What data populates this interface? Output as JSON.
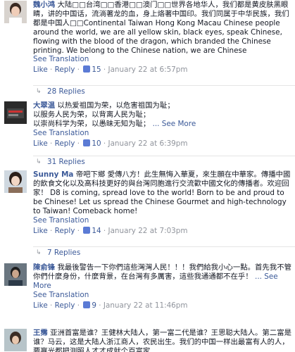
{
  "comments": [
    {
      "author": "魏小鸿",
      "text": "大陆□□台湾□□香港□□澳门□□世界各地华人，我们都是黄皮肤黑眼睛，讲的中国话，流淌著龙的血，身上烙著中国印。我们同属于中华民族，我们都是中国人□□Continental Taiwan Hong Kong Macau Chinese people around the world, we are all yellow skin, black eyes, speak Chinese, flowing with the blood of the dragon, which branded the Chinese printing. We belong to the Chinese nation, we are Chinese",
      "see_translation": "See Translation",
      "like": "Like",
      "reply": "Reply",
      "likes": "15",
      "timestamp": "January 22 at 6:57pm",
      "replies": "28 Replies"
    },
    {
      "author": "大翠温",
      "text_lines": [
        "以热爱祖国为荣，以危害祖国为耻；",
        "以服务人民为荣，以背离人民为耻；",
        "以崇尚科学为荣，以愚昧无知为耻；"
      ],
      "see_more": "... See More",
      "see_translation": "See Translation",
      "like": "Like",
      "reply": "Reply",
      "likes": "10",
      "timestamp": "January 22 at 6:39pm",
      "replies": "31 Replies"
    },
    {
      "author": "Sunny Ma",
      "text": "帝吧下鄉 愛傳八方！此生無悔入華夏，來生願在中華家。傳播中國的飲食文化以及高科技更好的與台灣同胞進行交流歡中國文化的傳播者。欢迎回家！ D8 is coming, spread love to the world! Born to be and proud to be Chinese! Let us spread the Chinese Gourmet and high-technology to Taiwan! Comeback home!",
      "see_translation": "See Translation",
      "like": "Like",
      "reply": "Reply",
      "likes": "14",
      "timestamp": "January 22 at 7:03pm",
      "replies": "7 Replies"
    },
    {
      "author": "陳俞锋",
      "text": "我最後警告一下你們這些灣灣人民！！！我們給我小心一點。首先我不管你們什麼身份，什麼背景，在台灣有多厲害，這些我通通都不在乎！",
      "see_more": "... See More",
      "see_translation": "See Translation",
      "like": "Like",
      "reply": "Reply",
      "likes": "9",
      "timestamp": "January 22 at 11:46pm"
    },
    {
      "author": "王霈",
      "text": "亚洲首富是谁？王健林大陆人，第一富二代是谁？王思聪大陆人。第二富是谁？马云，这是大陆人浙江商人，农民出生。我们的中国一样出最富有人的人，要赢光都把测照人才才成就个百富家"
    }
  ]
}
